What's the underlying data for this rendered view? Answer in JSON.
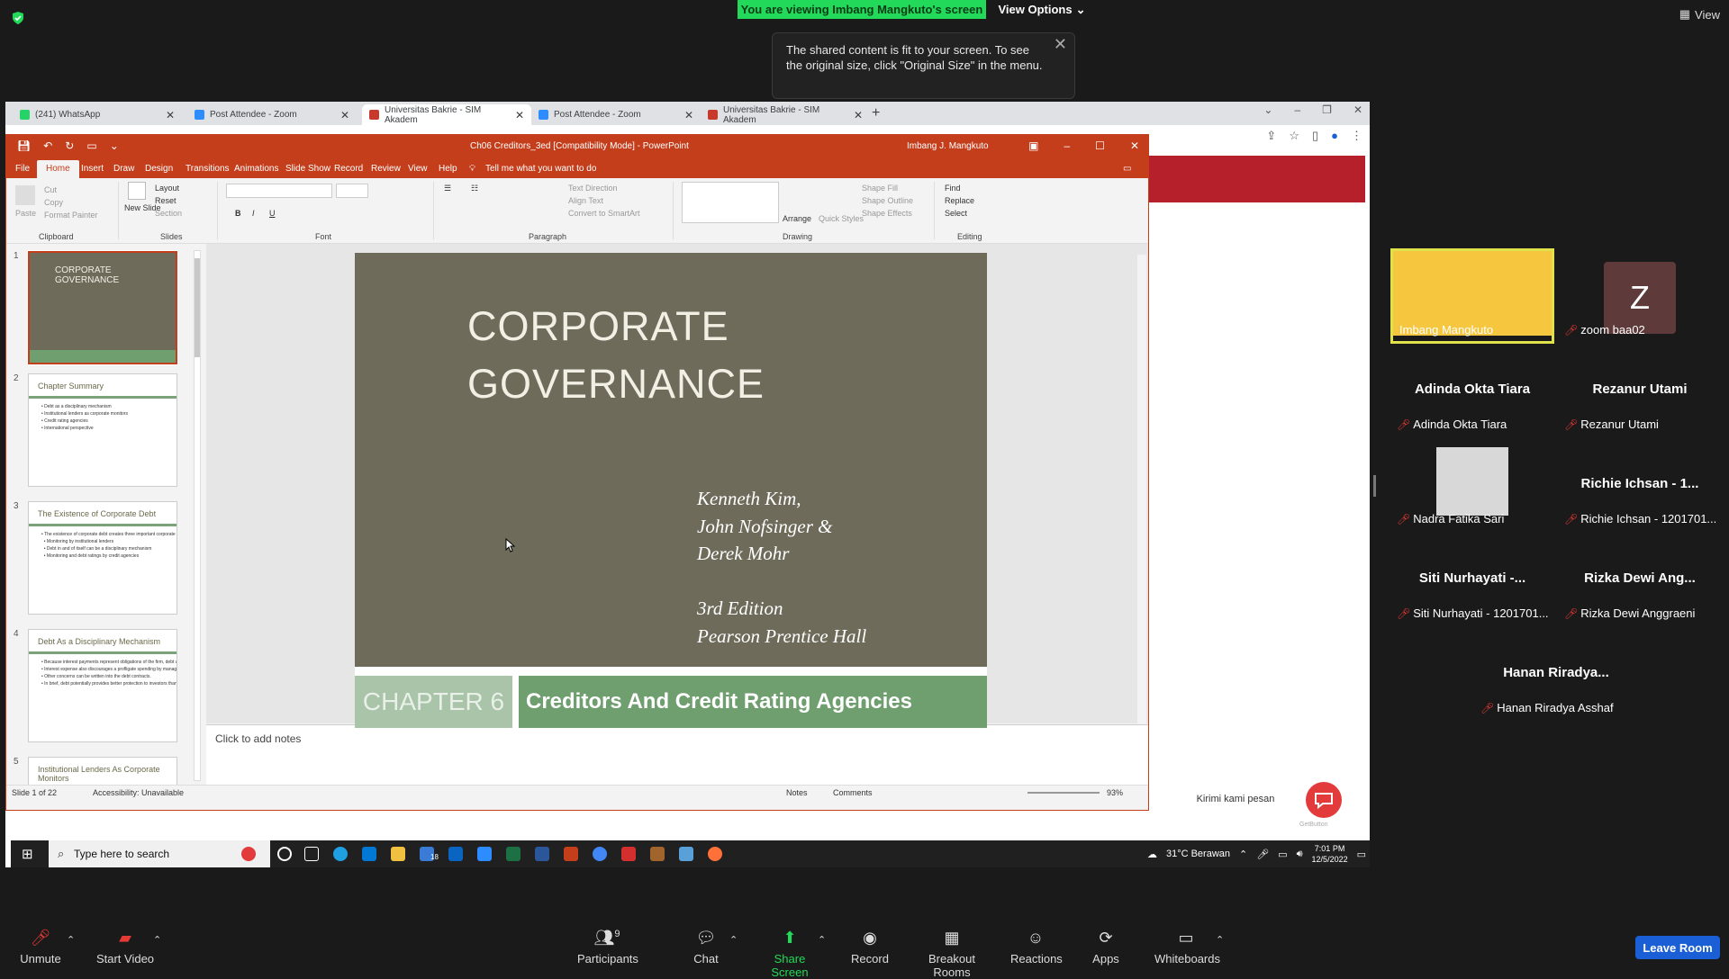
{
  "banner": {
    "viewing": "You are viewing Imbang Mangkuto's screen",
    "view_options": "View Options",
    "view_top": "View"
  },
  "tooltip": {
    "text": "The shared content is fit to your screen. To see the original size, click \"Original Size\" in the menu."
  },
  "browser": {
    "tabs": [
      {
        "label": "(241) WhatsApp",
        "color": "#25d366"
      },
      {
        "label": "Post Attendee - Zoom",
        "color": "#2d8cff"
      },
      {
        "label": "Universitas Bakrie - SIM Akadem",
        "color": "#c8392b"
      },
      {
        "label": "Post Attendee - Zoom",
        "color": "#2d8cff"
      },
      {
        "label": "Universitas Bakrie - SIM Akadem",
        "color": "#c8392b"
      }
    ]
  },
  "ppt": {
    "title": "Ch06 Creditors_3ed [Compatibility Mode] - PowerPoint",
    "user": "Imbang J. Mangkuto",
    "tabs": [
      "File",
      "Home",
      "Insert",
      "Draw",
      "Design",
      "Transitions",
      "Animations",
      "Slide Show",
      "Record",
      "Review",
      "View",
      "Help"
    ],
    "tell_me": "Tell me what you want to do",
    "ribbon": {
      "paste": "Paste",
      "cut": "Cut",
      "copy": "Copy",
      "format_painter": "Format Painter",
      "clipboard": "Clipboard",
      "new_slide": "New Slide",
      "layout": "Layout",
      "reset": "Reset",
      "section": "Section",
      "slides": "Slides",
      "font": "Font",
      "paragraph": "Paragraph",
      "text_direction": "Text Direction",
      "align_text": "Align Text",
      "convert_smartart": "Convert to SmartArt",
      "arrange": "Arrange",
      "quick_styles": "Quick Styles",
      "shape_fill": "Shape Fill",
      "shape_outline": "Shape Outline",
      "shape_effects": "Shape Effects",
      "drawing": "Drawing",
      "find": "Find",
      "replace": "Replace",
      "select": "Select",
      "editing": "Editing"
    },
    "thumbnails": [
      {
        "num": "1",
        "title": "CORPORATE GOVERNANCE",
        "lines": ""
      },
      {
        "num": "2",
        "title": "Chapter Summary",
        "lines": "• Debt as a disciplinary mechanism\n• Institutional lenders as corporate monitors\n• Credit rating agencies\n• International perspective"
      },
      {
        "num": "3",
        "title": "The Existence of Corporate Debt",
        "lines": "• The existence of corporate debt creates three important corporate system monitors or devices:\n  • Monitoring by institutional lenders\n  • Debt in and of itself can be a disciplinary mechanism\n  • Monitoring and debt ratings by credit agencies"
      },
      {
        "num": "4",
        "title": "Debt As a Disciplinary Mechanism",
        "lines": "• Because interest payments represent obligations of the firm, debt actually imposes discipline on to the firm's management.\n• Interest expense also discourages a profligate spending by management.\n• Other concerns can be written into the debt contracts.\n• In brief, debt potentially provides better protection to investors than equity."
      },
      {
        "num": "5",
        "title": "Institutional Lenders As Corporate Monitors",
        "lines": ""
      }
    ],
    "slide": {
      "title_line1": "CORPORATE",
      "title_line2": "GOVERNANCE",
      "author1": "Kenneth Kim,",
      "author2": "John Nofsinger &",
      "author3": "Derek Mohr",
      "edition": "3rd Edition",
      "publisher": "Pearson Prentice Hall",
      "chapter": "CHAPTER 6",
      "chapter_title": "Creditors And Credit Rating Agencies"
    },
    "notes_placeholder": "Click to add notes",
    "status": {
      "slide": "Slide 1 of 22",
      "accessibility": "Accessibility: Unavailable",
      "notes": "Notes",
      "comments": "Comments",
      "zoom": "93%"
    }
  },
  "taskbar": {
    "search": "Type here to search",
    "weather": "31°C  Berawan",
    "time": "7:01 PM",
    "date": "12/5/2022",
    "mail_badge": "18"
  },
  "chat_widget": {
    "bubble": "Kirimi kami pesan",
    "getbutton": "GetButton"
  },
  "gallery": [
    {
      "label": "Imbang Mangkuto",
      "big": ""
    },
    {
      "label": "zoom baa02",
      "big": "",
      "avatar": "Z"
    },
    {
      "label": "Adinda Okta Tiara",
      "big": "Adinda Okta Tiara"
    },
    {
      "label": "Rezanur Utami",
      "big": "Rezanur Utami"
    },
    {
      "label": "Nadra Fatika Sari",
      "big": ""
    },
    {
      "label": "Richie Ichsan - 1201701...",
      "big": "Richie Ichsan - 1..."
    },
    {
      "label": "Siti Nurhayati - 1201701...",
      "big": "Siti Nurhayati -..."
    },
    {
      "label": "Rizka Dewi Anggraeni",
      "big": "Rizka Dewi Ang..."
    },
    {
      "label": "Hanan Riradya Asshaf",
      "big": "Hanan Riradya..."
    }
  ],
  "zoombar": {
    "unmute": "Unmute",
    "start_video": "Start Video",
    "participants": "Participants",
    "participant_count": "9",
    "chat": "Chat",
    "share_screen": "Share Screen",
    "record": "Record",
    "breakout": "Breakout Rooms",
    "reactions": "Reactions",
    "apps": "Apps",
    "whiteboards": "Whiteboards",
    "leave": "Leave Room"
  }
}
